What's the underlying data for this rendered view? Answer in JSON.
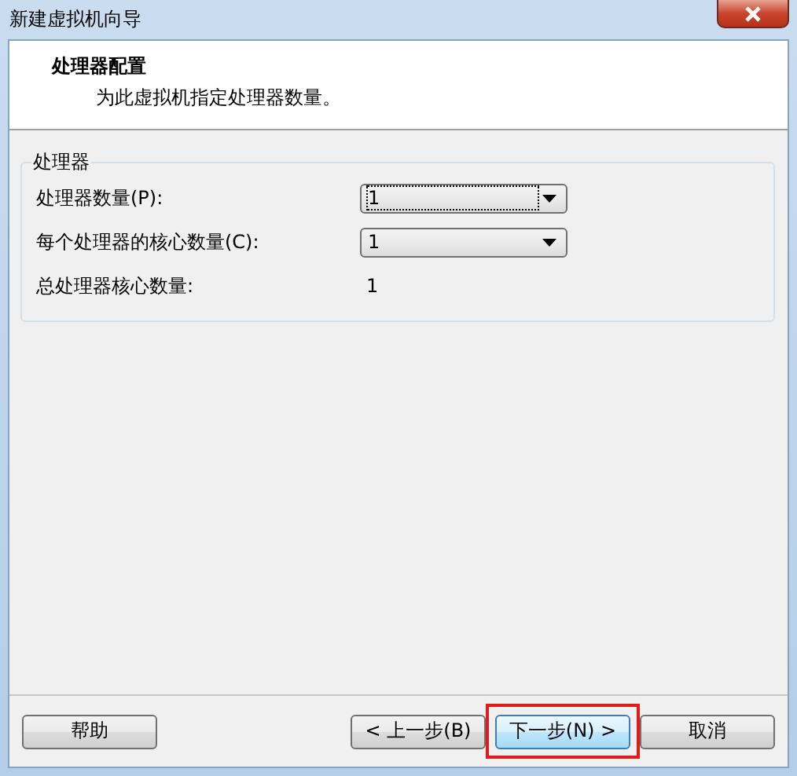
{
  "window": {
    "title": "新建虚拟机向导"
  },
  "header": {
    "title": "处理器配置",
    "subtitle": "为此虚拟机指定处理器数量。"
  },
  "group": {
    "title": "处理器",
    "rows": [
      {
        "kind": "dropdown",
        "label": "处理器数量(P):",
        "value": "1",
        "focused": true
      },
      {
        "kind": "dropdown",
        "label": "每个处理器的核心数量(C):",
        "value": "1",
        "focused": false
      },
      {
        "kind": "readout",
        "label": "总处理器核心数量:",
        "value": "1"
      }
    ]
  },
  "buttons": [
    {
      "label": "帮助",
      "default": false,
      "highlighted": false
    },
    {
      "label": "< 上一步(B)",
      "default": false,
      "highlighted": false
    },
    {
      "label": "下一步(N) >",
      "default": true,
      "highlighted": true
    },
    {
      "label": "取消",
      "default": false,
      "highlighted": false
    }
  ]
}
